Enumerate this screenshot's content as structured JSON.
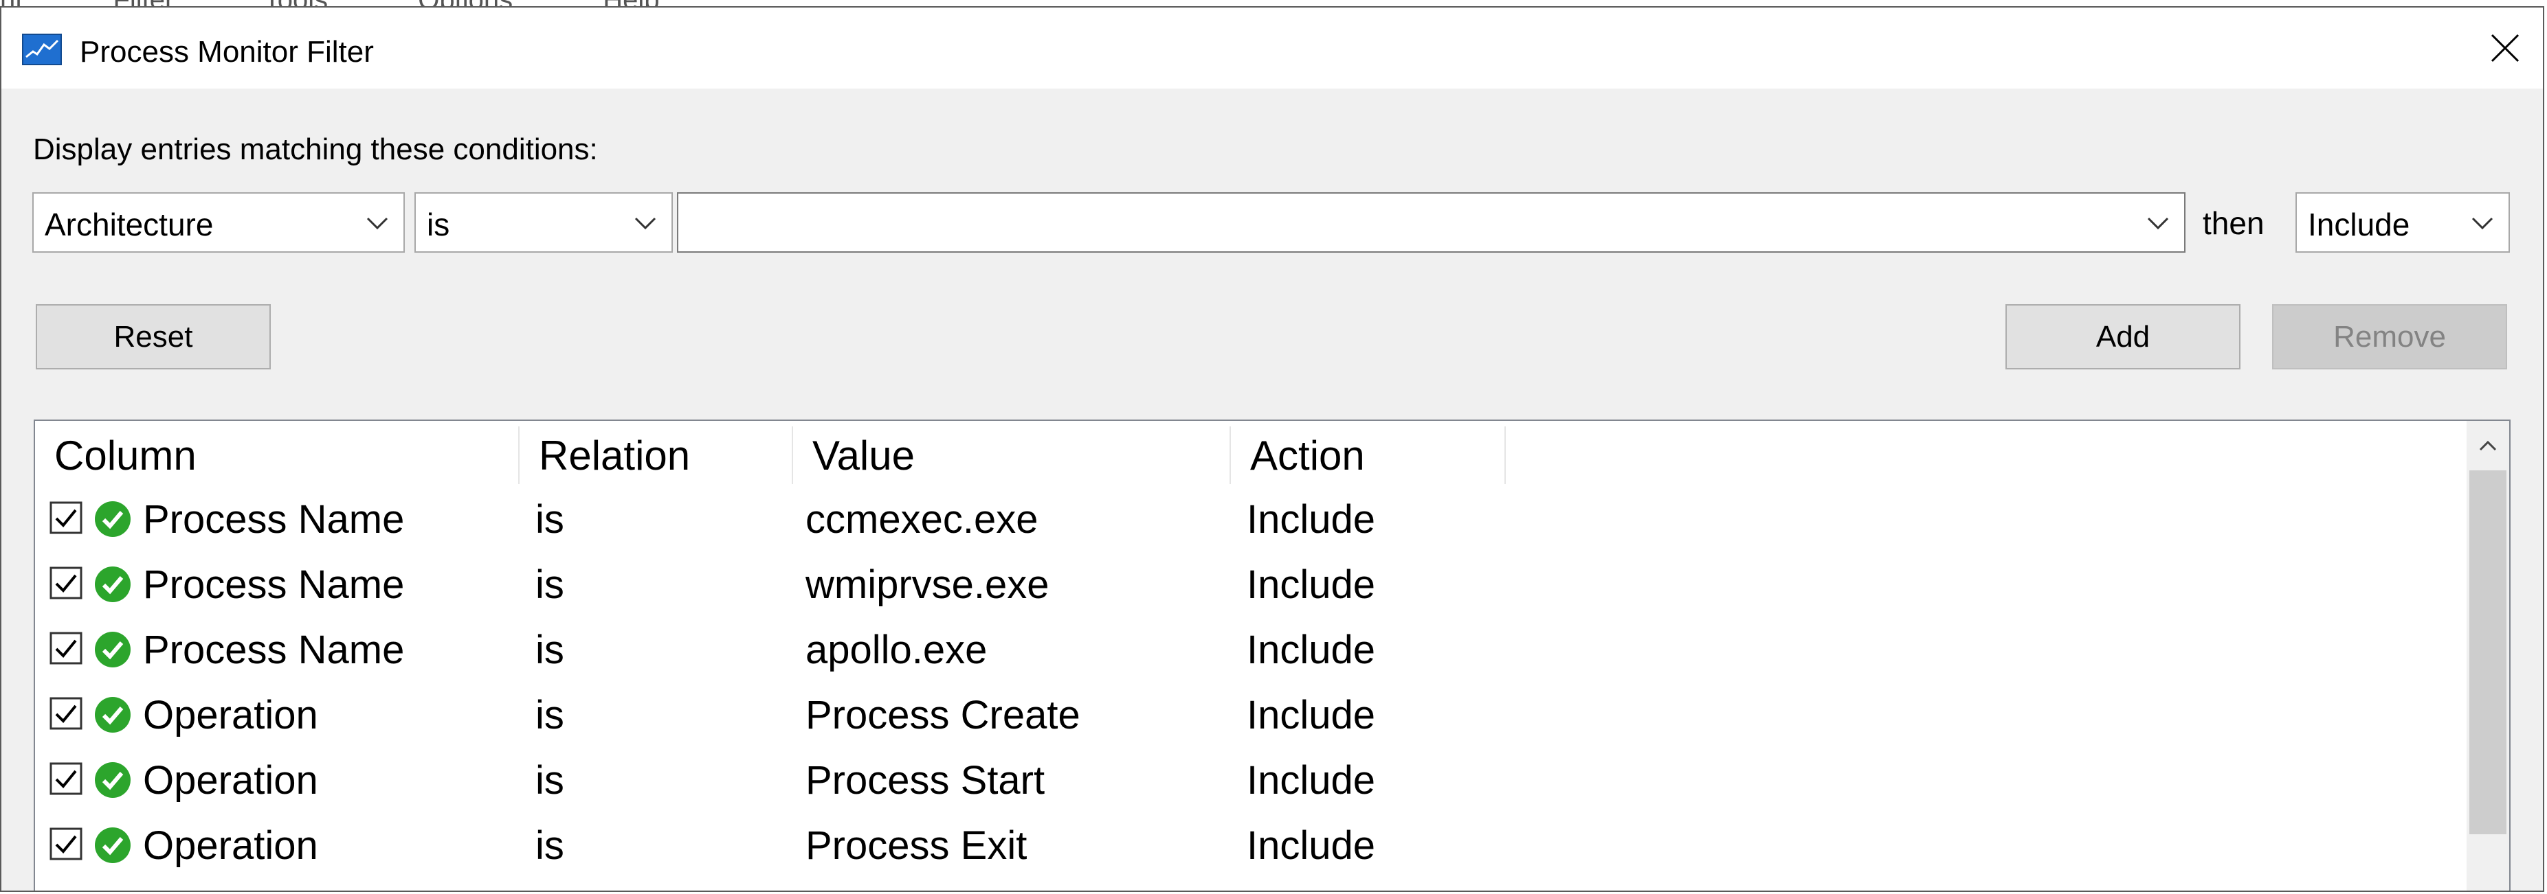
{
  "background_menu": [
    "nt",
    "Filter",
    "Tools",
    "Options",
    "Help"
  ],
  "window": {
    "title": "Process Monitor Filter",
    "app_icon": "process-monitor-icon",
    "close_icon": "close-icon"
  },
  "filter_builder": {
    "prompt": "Display entries matching these conditions:",
    "column_select": "Architecture",
    "relation_select": "is",
    "value_input": "",
    "then_label": "then",
    "action_select": "Include"
  },
  "buttons": {
    "reset": "Reset",
    "add": "Add",
    "remove": "Remove"
  },
  "rules_table": {
    "headers": [
      "Column",
      "Relation",
      "Value",
      "Action"
    ],
    "rows": [
      {
        "column": "Process Name",
        "relation": "is",
        "value": "ccmexec.exe",
        "action": "Include",
        "enabled": true
      },
      {
        "column": "Process Name",
        "relation": "is",
        "value": "wmiprvse.exe",
        "action": "Include",
        "enabled": true
      },
      {
        "column": "Process Name",
        "relation": "is",
        "value": "apollo.exe",
        "action": "Include",
        "enabled": true
      },
      {
        "column": "Operation",
        "relation": "is",
        "value": "Process Create",
        "action": "Include",
        "enabled": true
      },
      {
        "column": "Operation",
        "relation": "is",
        "value": "Process Start",
        "action": "Include",
        "enabled": true
      },
      {
        "column": "Operation",
        "relation": "is",
        "value": "Process Exit",
        "action": "Include",
        "enabled": true
      }
    ]
  },
  "colors": {
    "include_icon": "#2ca52c",
    "accent": "#1f6fd0"
  }
}
